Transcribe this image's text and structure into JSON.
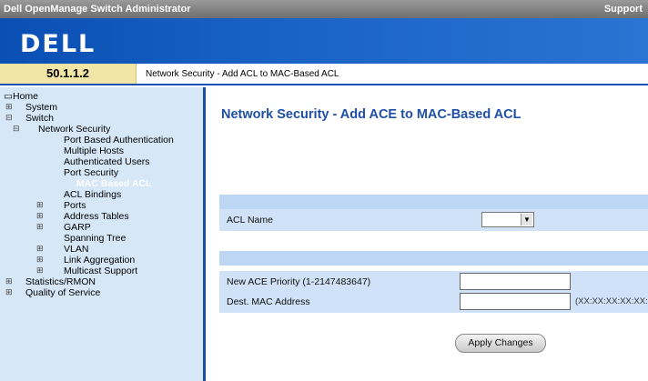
{
  "header": {
    "app_title": "Dell OpenManage Switch Administrator",
    "support_link": "Support",
    "logo_text": "DELL"
  },
  "ip_address": "50.1.1.2",
  "breadcrumb": "Network Security - Add ACL to MAC-Based ACL",
  "sidebar": {
    "home": "Home",
    "system": "System",
    "switch": "Switch",
    "network_security": "Network Security",
    "port_based_auth": "Port Based Authentication",
    "multiple_hosts": "Multiple Hosts",
    "authenticated_users": "Authenticated Users",
    "port_security": "Port Security",
    "mac_based_acl": "MAC Based ACL",
    "acl_bindings": "ACL Bindings",
    "ports": "Ports",
    "address_tables": "Address Tables",
    "garp": "GARP",
    "spanning_tree": "Spanning Tree",
    "vlan": "VLAN",
    "link_aggregation": "Link Aggregation",
    "multicast_support": "Multicast Support",
    "statistics_rmon": "Statistics/RMON",
    "quality_of_service": "Quality of Service"
  },
  "main": {
    "title": "Network Security - Add ACE to MAC-Based ACL",
    "acl_name_label": "ACL Name",
    "acl_name_value": "",
    "new_ace_priority_label": "New ACE Priority (1-2147483647)",
    "dest_mac_label": "Dest. MAC Address",
    "dest_mac_hint": "(XX:XX:XX:XX:XX:XX)",
    "apply_button": "Apply Changes"
  },
  "colors": {
    "accent": "#1458c9",
    "title": "#1f4fa6",
    "sidebar_bg": "#d6e7f7",
    "row_bg": "#cfe2f7"
  }
}
